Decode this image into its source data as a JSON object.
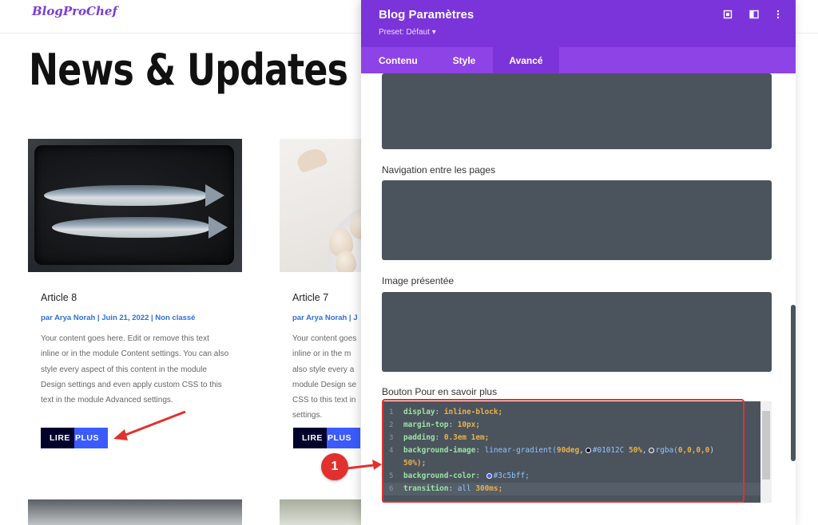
{
  "site": {
    "logo": "BlogProChef",
    "page_title": "News & Updates"
  },
  "articles": [
    {
      "title": "Article 8",
      "meta": "par Arya Norah | Juin 21, 2022 | Non classé",
      "excerpt": "Your content goes here. Edit or remove this text inline or in the module Content settings. You can also style every aspect of this content in the module Design settings and even apply custom CSS to this text in the module Advanced settings.",
      "button_left": "LIRE",
      "button_right": "PLUS"
    },
    {
      "title": "Article 7",
      "meta": "par Arya Norah | J",
      "excerpt": "Your content goes inline or in the m also style every a module Design se CSS to this text in settings.",
      "button_left": "LIRE",
      "button_right": "PLUS"
    }
  ],
  "panel": {
    "title": "Blog Paramètres",
    "preset": "Preset: Défaut ▾",
    "icons": [
      "fullscreen-icon",
      "split-view-icon",
      "more-icon"
    ],
    "tabs": [
      {
        "label": "Contenu",
        "active": false
      },
      {
        "label": "Style",
        "active": false
      },
      {
        "label": "Avancé",
        "active": true
      }
    ],
    "fields": {
      "navigation_label": "Navigation entre les pages",
      "image_label": "Image présentée",
      "button_label": "Bouton Pour en savoir plus"
    },
    "code_lines": [
      {
        "n": "1",
        "prop": "display",
        "value": "inline-block;"
      },
      {
        "n": "2",
        "prop": "margin-top",
        "value": "10px;"
      },
      {
        "n": "3",
        "prop": "padding",
        "value": "0.3em 1em;"
      },
      {
        "n": "4",
        "prop": "background-image",
        "fn": "linear-gradient(",
        "arg1": "90deg",
        "color1": "#01012C",
        "stop1": "50%",
        "fn2": "rgba(",
        "arg2": "0,0,0,0",
        "close": ")"
      },
      {
        "n": "",
        "cont": "50%);"
      },
      {
        "n": "5",
        "prop": "background-color",
        "color": "#3c5bff",
        "value": "#3c5bff;"
      },
      {
        "n": "6",
        "prop": "transition",
        "kw": "all",
        "value": "300ms;"
      }
    ]
  },
  "annotation": {
    "badge": "1"
  },
  "colors": {
    "accent_purple": "#7b34d9",
    "tab_bar": "#8e43e6",
    "button_dark": "#01012c",
    "button_blue": "#3c5bff",
    "annotation_red": "#e0312f"
  }
}
